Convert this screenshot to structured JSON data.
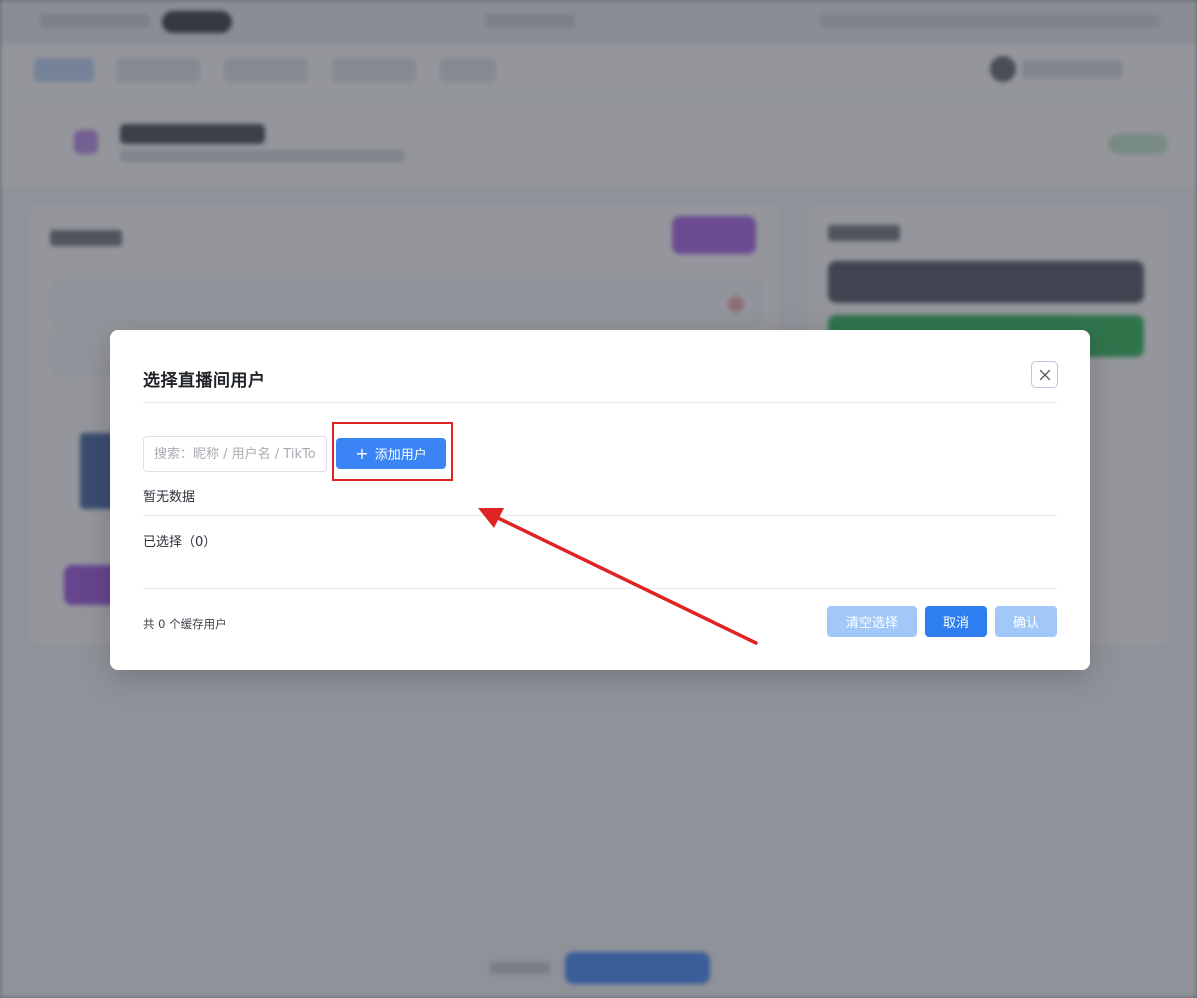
{
  "dialog": {
    "title": "选择直播间用户",
    "search": {
      "placeholder": "搜索：昵称 / 用户名 / TikTok",
      "value": ""
    },
    "add_user_label": "添加用户",
    "empty_text": "暂无数据",
    "selected_text": "已选择（0）",
    "cache_text": "共 0 个缓存用户",
    "buttons": {
      "clear": "清空选择",
      "cancel": "取消",
      "confirm": "确认"
    }
  },
  "icons": {
    "close": "close-icon",
    "add": "plus-icon"
  },
  "colors": {
    "primary": "#3a84f5",
    "primary_disabled": "#a2c7f9",
    "annotation": "#e02424"
  }
}
